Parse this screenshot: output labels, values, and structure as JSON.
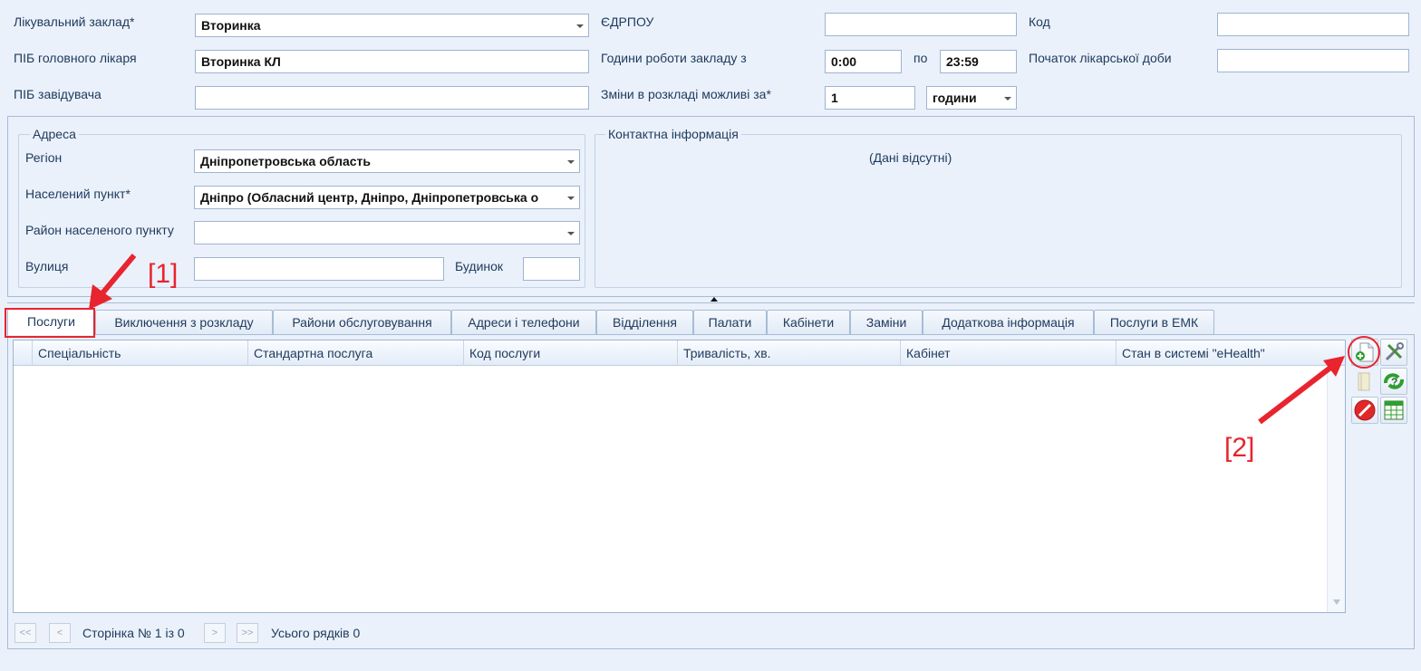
{
  "top": {
    "facility_label": "Лікувальний заклад*",
    "facility_value": "Вторинка",
    "edrpou_label": "ЄДРПОУ",
    "edrpou_value": "",
    "code_label": "Код",
    "code_value": "",
    "chief_label": "ПІБ головного лікаря",
    "chief_value": "Вторинка КЛ",
    "hours_label": "Години роботи закладу з",
    "hours_from": "0:00",
    "hours_to_label": "по",
    "hours_to": "23:59",
    "day_start_label": "Початок лікарської доби",
    "day_start_value": "",
    "head_label": "ПІБ завідувача",
    "head_value": "",
    "changes_label": "Зміни в розкладі можливі за*",
    "changes_value": "1",
    "changes_unit": "години"
  },
  "address": {
    "title": "Адреса",
    "region_label": "Регіон",
    "region_value": "Дніпропетровська область",
    "locality_label": "Населений пункт*",
    "locality_value": "Дніпро (Обласний центр, Дніпро, Дніпропетровська о",
    "district_label": "Район населеного пункту",
    "district_value": "",
    "street_label": "Вулиця",
    "street_value": "",
    "building_label": "Будинок",
    "building_value": ""
  },
  "contact": {
    "title": "Контактна інформація",
    "empty_text": "(Дані відсутні)"
  },
  "tabs": [
    "Послуги",
    "Виключення з розкладу",
    "Райони обслуговування",
    "Адреси і телефони",
    "Відділення",
    "Палати",
    "Кабінети",
    "Заміни",
    "Додаткова інформація",
    "Послуги в ЕМК"
  ],
  "grid": {
    "columns": [
      "Спеціальність",
      "Стандартна послуга",
      "Код послуги",
      "Тривалість, хв.",
      "Кабінет",
      "Стан в системі \"eHealth\""
    ]
  },
  "pager": {
    "first": "<<",
    "prev": "<",
    "next": ">",
    "last": ">>",
    "page_text": "Сторінка № 1 із 0",
    "total_text": "Усього рядків 0"
  },
  "annotations": {
    "mark1": "[1]",
    "mark2": "[2]"
  },
  "toolbar_icons": [
    "add-document-icon",
    "settings-tools-icon",
    "book-icon",
    "refresh-question-icon",
    "delete-icon",
    "excel-icon"
  ],
  "colors": {
    "background": "#eaf1fb",
    "annotation_red": "#e8242e",
    "label_text": "#1e395b"
  }
}
